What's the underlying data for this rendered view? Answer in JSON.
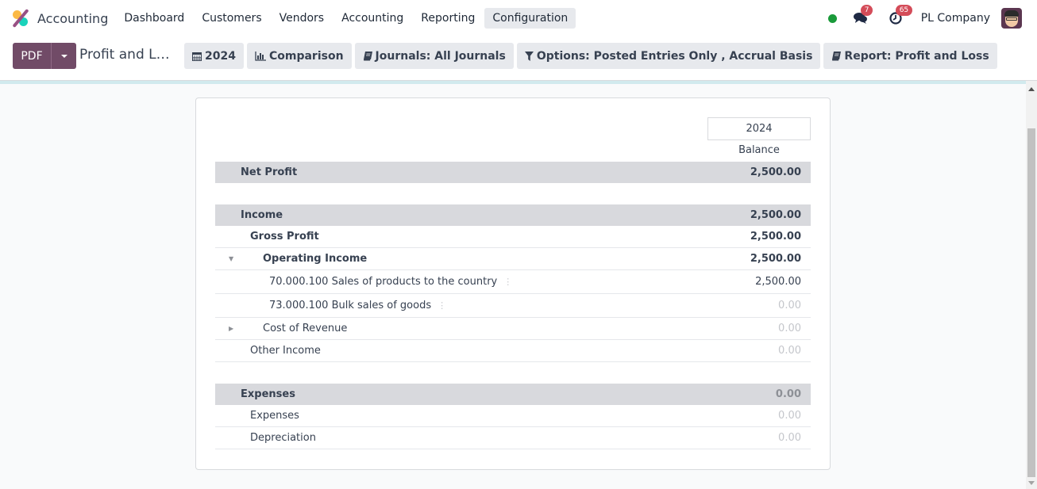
{
  "navbar": {
    "app_name": "Accounting",
    "menu": [
      {
        "label": "Dashboard",
        "active": false
      },
      {
        "label": "Customers",
        "active": false
      },
      {
        "label": "Vendors",
        "active": false
      },
      {
        "label": "Accounting",
        "active": false
      },
      {
        "label": "Reporting",
        "active": false
      },
      {
        "label": "Configuration",
        "active": true
      }
    ],
    "systray": {
      "presence_status": "online",
      "presence_color": "#1a9a3a",
      "messages_icon": "comments-icon",
      "messages_count": "7",
      "activities_icon": "clock-icon",
      "activities_count": "65",
      "company": "PL Company",
      "avatar_icon": "user-avatar"
    }
  },
  "control_panel": {
    "pdf_label": "PDF",
    "report_title": "Profit and L…",
    "filters": [
      {
        "icon": "calendar-icon",
        "label": "2024"
      },
      {
        "icon": "bar-chart-icon",
        "label": "Comparison"
      },
      {
        "icon": "book-icon",
        "label": "Journals: All Journals"
      },
      {
        "icon": "filter-icon",
        "label": "Options: Posted Entries Only , Accrual Basis"
      },
      {
        "icon": "book-icon",
        "label": "Report: Profit and Loss"
      }
    ]
  },
  "report": {
    "column_period": "2024",
    "column_label": "Balance",
    "rows": [
      {
        "label": "Net Profit",
        "value": "2,500.00",
        "type": "section"
      },
      {
        "label": "",
        "value": "",
        "type": "spacer"
      },
      {
        "label": "Income",
        "value": "2,500.00",
        "type": "section"
      },
      {
        "label": "Gross Profit",
        "value": "2,500.00",
        "type": "bold"
      },
      {
        "label": "Operating Income",
        "value": "2,500.00",
        "type": "bold",
        "toggle": "expanded"
      },
      {
        "label": "70.000.100 Sales of products to the country",
        "value": "2,500.00",
        "type": "account"
      },
      {
        "label": "73.000.100 Bulk sales of goods",
        "value": "0.00",
        "type": "account"
      },
      {
        "label": "Cost of Revenue",
        "value": "0.00",
        "type": "normal",
        "toggle": "collapsed"
      },
      {
        "label": "Other Income",
        "value": "0.00",
        "type": "normal"
      },
      {
        "label": "",
        "value": "",
        "type": "spacer"
      },
      {
        "label": "Expenses",
        "value": "0.00",
        "type": "section"
      },
      {
        "label": "Expenses",
        "value": "0.00",
        "type": "normal"
      },
      {
        "label": "Depreciation",
        "value": "0.00",
        "type": "normal"
      }
    ]
  },
  "colors": {
    "brand_primary": "#714b67",
    "section_bg": "#d8d9dd",
    "badge": "#d44c59"
  }
}
